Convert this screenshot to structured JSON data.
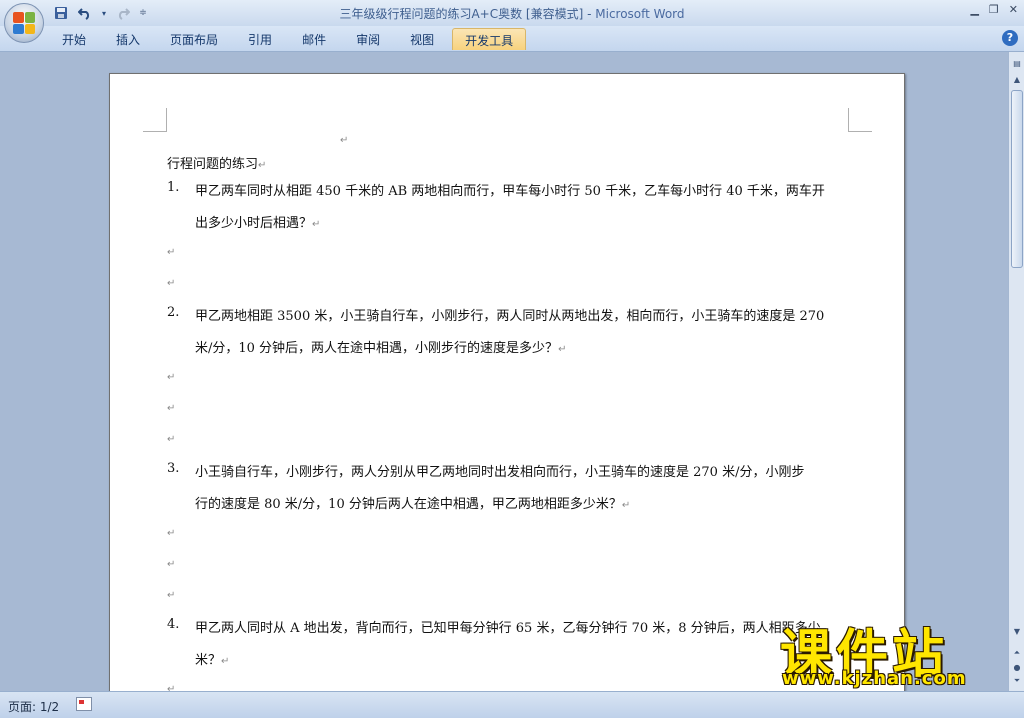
{
  "window": {
    "title": "三年级级行程问题的练习A+C奥数 [兼容模式]",
    "separator": " - ",
    "app": "Microsoft Word"
  },
  "ribbon": {
    "tabs": [
      "开始",
      "插入",
      "页面布局",
      "引用",
      "邮件",
      "审阅",
      "视图",
      "开发工具"
    ],
    "active_tab": "开发工具"
  },
  "document": {
    "heading": "行程问题的练习",
    "paragraph_mark": "↵",
    "problems": [
      {
        "number": "1.",
        "line1": "甲乙两车同时从相距 450 千米的 AB 两地相向而行，甲车每小时行 50 千米，乙车每小时行 40 千米，两车开",
        "line2": "出多少小时后相遇？"
      },
      {
        "number": "2.",
        "line1": "甲乙两地相距 3500 米，小王骑自行车，小刚步行，两人同时从两地出发，相向而行，小王骑车的速度是 270",
        "line2": "米/分，10 分钟后，两人在途中相遇，小刚步行的速度是多少？"
      },
      {
        "number": "3.",
        "line1": "小王骑自行车，小刚步行，两人分别从甲乙两地同时出发相向而行，小王骑车的速度是 270 米/分，小刚步",
        "line2": "行的速度是 80 米/分，10 分钟后两人在途中相遇，甲乙两地相距多少米？"
      },
      {
        "number": "4.",
        "line1": "甲乙两人同时从 A 地出发，背向而行，已知甲每分钟行 65 米，乙每分钟行 70 米，8 分钟后，两人相距多少",
        "line2": "米？"
      }
    ]
  },
  "statusbar": {
    "page": "页面: 1/2"
  },
  "watermark": {
    "text": "课件站",
    "url": "www.kjzhan.com"
  },
  "colors": {
    "active_tab": "#f7d27e",
    "doc_background": "#a7b9d3",
    "watermark": "#ffe600"
  }
}
